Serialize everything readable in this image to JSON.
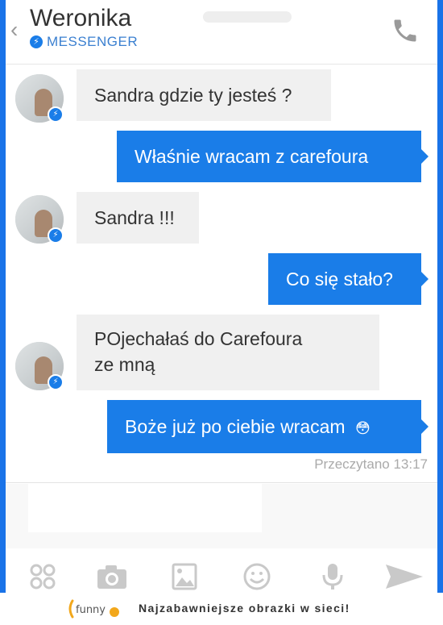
{
  "header": {
    "back_icon": "chevron-left-icon",
    "contact_name": "Weronika",
    "platform_label": "MESSENGER",
    "call_icon": "phone-icon"
  },
  "messages": [
    {
      "direction": "incoming",
      "text": "Sandra gdzie ty jesteś ?"
    },
    {
      "direction": "outgoing",
      "text": "Właśnie wracam z carefoura"
    },
    {
      "direction": "incoming",
      "text": "Sandra !!!"
    },
    {
      "direction": "outgoing",
      "text": "Co się stało?"
    },
    {
      "direction": "incoming",
      "text_line1": "POjechałaś do Carefoura",
      "text_line2": "ze mną"
    },
    {
      "direction": "outgoing",
      "text": "Boże już po ciebie wracam",
      "emoji": "😳"
    }
  ],
  "read_receipt": "Przeczytano 13:17",
  "toolbar": {
    "icons": [
      "stickers-icon",
      "camera-icon",
      "gallery-icon",
      "emoji-icon",
      "microphone-icon",
      "send-icon"
    ]
  },
  "footer": {
    "logo_text": "funny",
    "tagline": "Najzabawniejsze obrazki w sieci!"
  },
  "colors": {
    "accent": "#1a7de8",
    "incoming_bubble": "#f0f0f0"
  }
}
